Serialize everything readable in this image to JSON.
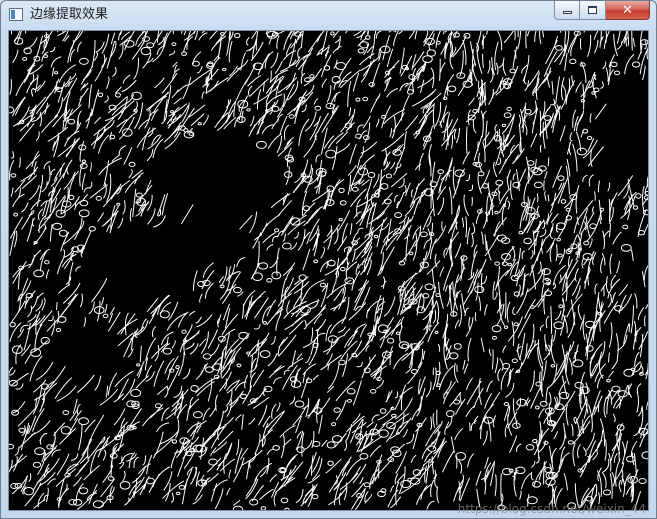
{
  "window": {
    "title": "边缘提取效果",
    "buttons": {
      "minimize": "minimize",
      "maximize": "maximize",
      "close": "✕"
    }
  },
  "image": {
    "description_icon": "edge-map-image",
    "watermark": "https://blog.csdn.net/weixin_44"
  },
  "colors": {
    "edge": "#ffffff",
    "background": "#000000",
    "titlebar": "#cfdff0",
    "close": "#c8443a"
  }
}
